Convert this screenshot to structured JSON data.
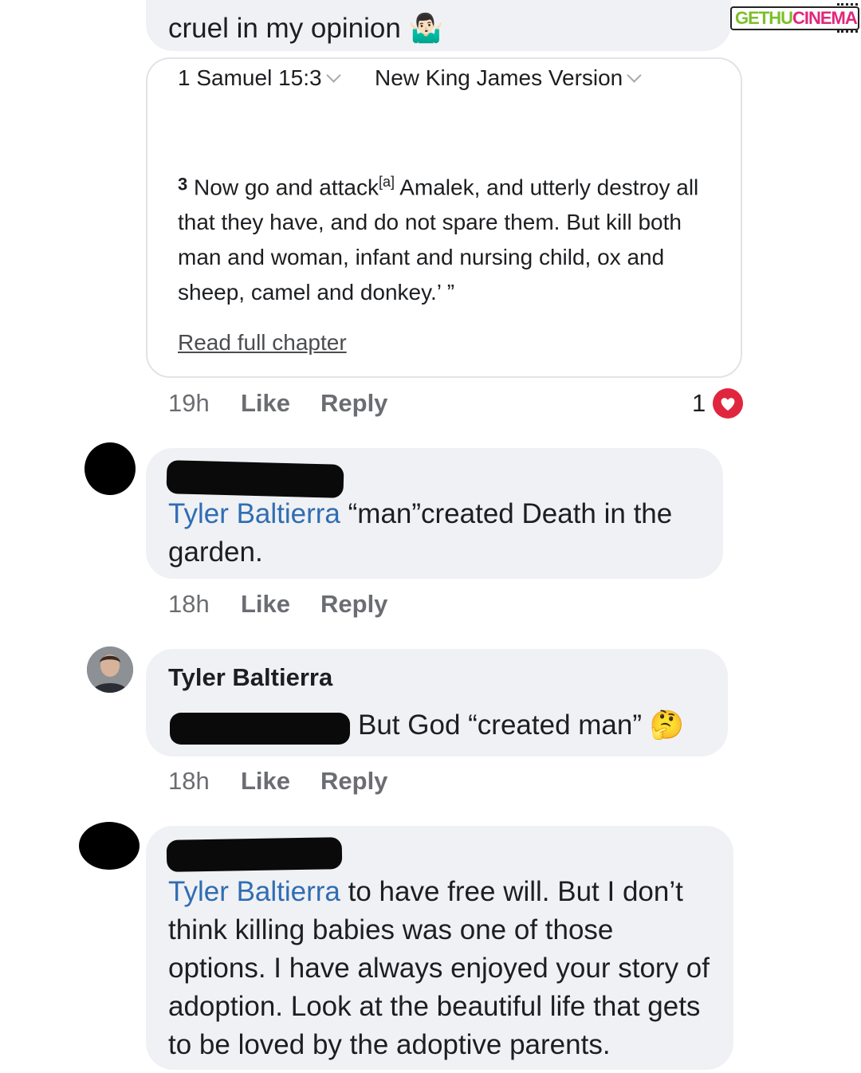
{
  "top_comment": {
    "text_tail": "cruel in my opinion",
    "emoji": "🤷🏻‍♂️"
  },
  "verse_card": {
    "reference": "1 Samuel 15:3",
    "version": "New King James Version",
    "verse_number": "3",
    "verse_text_before": "Now go and attack",
    "footnote": "[a]",
    "verse_text_after": " Amalek, and utterly destroy all that they have, and do not spare them. But kill both man and woman, infant and nursing child, ox and sheep, camel and donkey.’ ”",
    "read_full": "Read full chapter"
  },
  "comments": [
    {
      "time": "19h",
      "like": "Like",
      "reply": "Reply",
      "reaction_count": "1"
    },
    {
      "mention": "Tyler Baltierra",
      "text": " “man”created Death in the garden.",
      "time": "18h",
      "like": "Like",
      "reply": "Reply"
    },
    {
      "author": "Tyler Baltierra",
      "text": "But God “created man”",
      "emoji": "🤔",
      "time": "18h",
      "like": "Like",
      "reply": "Reply"
    },
    {
      "mention": "Tyler Baltierra",
      "text": " to have free will. But I don’t think killing babies was one of those options. I have always enjoyed your story of adoption. Look at the beautiful life that gets to be loved by the adoptive parents."
    }
  ],
  "watermark": {
    "part1": "GETHU",
    "part2": "CINEMA"
  },
  "colors": {
    "bubble": "#f0f1f4",
    "link": "#2f6db3",
    "heart": "#e0263f",
    "watermark_green": "#7bbf2a",
    "watermark_pink": "#e0277a"
  }
}
